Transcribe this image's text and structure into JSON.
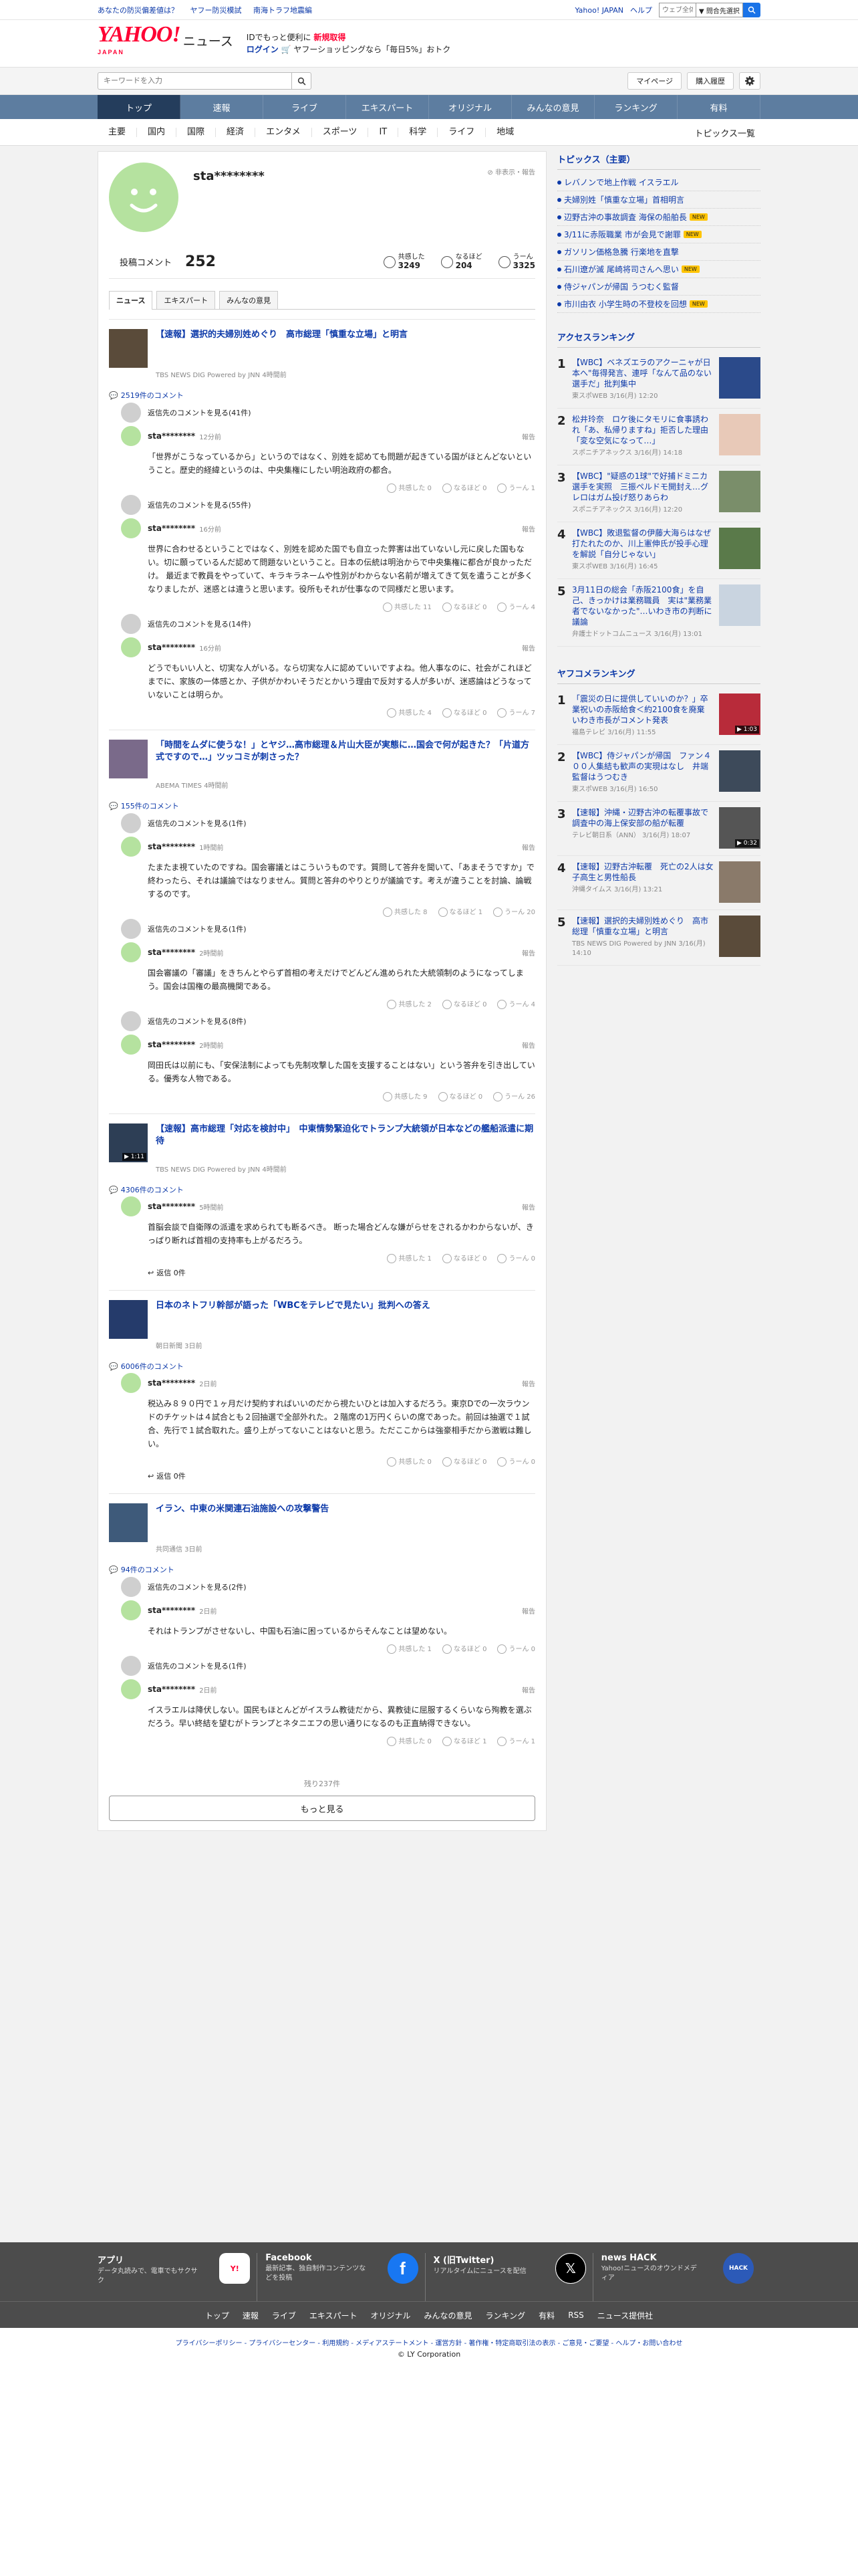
{
  "topstrip": {
    "links": [
      "あなたの防災偏差値は？",
      "ヤフー防災模試",
      "南海トラフ地震編"
    ],
    "right_links": [
      "Yahoo! JAPAN",
      "ヘルプ"
    ],
    "search_placeholder": "ウェブ全体",
    "select_value": "▼ 問合先選択"
  },
  "header": {
    "logo": "YAHOO!",
    "logo_sub": "JAPAN",
    "service": "ニュース",
    "promo_line1_a": "IDでもっと便利に",
    "promo_line1_b": "新規取得",
    "promo_line2_a": "ログイン",
    "promo_line2_b": "ヤフーショッピングなら「毎日5%」おトク"
  },
  "search": {
    "placeholder": "キーワードを入力",
    "mypage": "マイページ",
    "history": "購入履歴"
  },
  "nav": [
    "トップ",
    "速報",
    "ライブ",
    "エキスパート",
    "オリジナル",
    "みんなの意見",
    "ランキング",
    "有料"
  ],
  "subnav": [
    "主要",
    "国内",
    "国際",
    "経済",
    "エンタメ",
    "スポーツ",
    "IT",
    "科学",
    "ライフ",
    "地域"
  ],
  "subnav_right": "トピックス一覧",
  "profile": {
    "name": "sta********",
    "flag": "非表示・報告",
    "comment_label": "投稿コメント",
    "comment_count": "252",
    "reactions": [
      {
        "label": "共感した",
        "value": "3249"
      },
      {
        "label": "なるほど",
        "value": "204"
      },
      {
        "label": "うーん",
        "value": "3325"
      }
    ],
    "tabs": [
      "ニュース",
      "エキスパート",
      "みんなの意見"
    ]
  },
  "articles": [
    {
      "title": "【速報】選択的夫婦別姓めぐり　高市総理「慎重な立場」と明言",
      "source": "TBS NEWS DIG Powered by JNN 4時間前",
      "count": "2519件のコメント",
      "comments": [
        {
          "reply": "返信先のコメントを見る(41件)",
          "name": "sta********",
          "time": "12分前",
          "report": "報告",
          "text": "「世界がこうなっているから」というのではなく、別姓を認めても問題が起きている国がほとんどないということ。歴史的経緯というのは、中央集権にしたい明治政府の都合。",
          "reacts": [
            "共感した 0",
            "なるほど 0",
            "うーん 1"
          ]
        },
        {
          "reply": "返信先のコメントを見る(55件)",
          "name": "sta********",
          "time": "16分前",
          "report": "報告",
          "text": "世界に合わせるということではなく、別姓を認めた国でも自立った弊害は出ていないし元に戻した国もない。切に願っているんだ認めて問題ないということ。日本の伝統は明治からで中央集権に都合が良かっただけ。 最近まで教員をやっていて、キラキラネームや性別がわからない名前が増えてきて気を遣うことが多くなりましたが、迷惑とは違うと思います。役所もそれが仕事なので同様だと思います。",
          "reacts": [
            "共感した 11",
            "なるほど 0",
            "うーん 4"
          ]
        },
        {
          "reply": "返信先のコメントを見る(14件)",
          "name": "sta********",
          "time": "16分前",
          "report": "報告",
          "text": "どうでもいい人と、切実な人がいる。なら切実な人に認めていいですよね。他人事なのに、社会がこれほどまでに、家族の一体感とか、子供がかわいそうだとかいう理由で反対する人が多いが、迷惑論はどうなっていないことは明らか。",
          "reacts": [
            "共感した 4",
            "なるほど 0",
            "うーん 7"
          ]
        }
      ]
    },
    {
      "title": "「時間をムダに使うな！」とヤジ…高市総理＆片山大臣が実態に…国会で何が起きた？「片道方式ですので…」ツッコミが刺さった？",
      "source": "ABEMA TIMES 4時間前",
      "count": "155件のコメント",
      "comments": [
        {
          "reply": "返信先のコメントを見る(1件)",
          "name": "sta********",
          "time": "1時間前",
          "report": "報告",
          "text": "たまたま視ていたのですね。国会審議とはこういうものです。質問して答弁を聞いて、「あまそうですか」で終わったら、それは議論ではなりません。質問と答弁のやりとりが議論です。考えが違うことを討論、論戦するのです。",
          "reacts": [
            "共感した 8",
            "なるほど 1",
            "うーん 20"
          ]
        },
        {
          "reply": "返信先のコメントを見る(1件)",
          "name": "sta********",
          "time": "2時間前",
          "report": "報告",
          "text": "国会審議の「審議」をきちんとやらず首相の考えだけでどんどん進められた大統領制のようになってしまう。国会は国権の最高機関である。",
          "reacts": [
            "共感した 2",
            "なるほど 0",
            "うーん 4"
          ]
        },
        {
          "reply": "返信先のコメントを見る(8件)",
          "name": "sta********",
          "time": "2時間前",
          "report": "報告",
          "text": "岡田氏は以前にも、「安保法制によっても先制攻撃した国を支援することはない」という答弁を引き出している。優秀な人物である。",
          "reacts": [
            "共感した 9",
            "なるほど 0",
            "うーん 26"
          ]
        }
      ]
    },
    {
      "title": "【速報】高市総理「対応を検討中」　中東情勢緊迫化でトランプ大統領が日本などの艦船派遣に期待",
      "source": "TBS NEWS DIG Powered by JNN 4時間前",
      "thumb_badge": "▶ 1:11",
      "count": "4306件のコメント",
      "comments": [
        {
          "reply": "",
          "name": "sta********",
          "time": "5時間前",
          "report": "報告",
          "text": "首脳会談で自衛隊の派遣を求められても断るべき。 断った場合どんな嫌がらせをされるかわからないが、きっぱり断れば首相の支持率も上がるだろう。",
          "reacts": [
            "共感した 1",
            "なるほど 0",
            "うーん 0"
          ],
          "replies": "返信 0件"
        }
      ]
    },
    {
      "title": "日本のネトフリ幹部が語った「WBCをテレビで見たい」批判への答え",
      "source": "朝日新聞 3日前",
      "count": "6006件のコメント",
      "comments": [
        {
          "reply": "",
          "name": "sta********",
          "time": "2日前",
          "report": "報告",
          "text": "税込み８９０円で１ヶ月だけ契約すればいいのだから視たいひとは加入するだろう。東京Dでの一次ラウンドのチケットは４試合とも２回抽選で全部外れた。２階席の1万円くらいの席であった。前回は抽選で１試合、先行で１試合取れた。盛り上がってないことはないと思う。ただここからは強豪相手だから激戦は難しい。",
          "reacts": [
            "共感した 0",
            "なるほど 0",
            "うーん 0"
          ],
          "replies": "返信 0件"
        }
      ]
    },
    {
      "title": "イラン、中東の米関連石油施設への攻撃警告",
      "source": "共同通信 3日前",
      "count": "94件のコメント",
      "comments": [
        {
          "reply": "返信先のコメントを見る(2件)",
          "name": "sta********",
          "time": "2日前",
          "report": "報告",
          "text": "それはトランプがさせないし、中国も石油に困っているからそんなことは望めない。",
          "reacts": [
            "共感した 1",
            "なるほど 0",
            "うーん 0"
          ]
        },
        {
          "reply": "返信先のコメントを見る(1件)",
          "name": "sta********",
          "time": "2日前",
          "report": "報告",
          "text": "イスラエルは降伏しない。国民もほとんどがイスラム教徒だから、異教徒に屈服するくらいなら殉教を選ぶだろう。早い終結を望むがトランプとネタニエフの思い通りになるのも正直納得できない。",
          "reacts": [
            "共感した 0",
            "なるほど 1",
            "うーん 1"
          ]
        }
      ]
    }
  ],
  "more": {
    "remain": "残り237件",
    "button": "もっと見る"
  },
  "sidebar": {
    "topics_title": "トピックス（主要）",
    "topics": [
      {
        "t": "レバノンで地上作戦 イスラエル",
        "new": ""
      },
      {
        "t": "夫婦別姓「慎重な立場」首相明言",
        "new": ""
      },
      {
        "t": "辺野古沖の事故調査 海保の船舶長",
        "new": "NEW"
      },
      {
        "t": "3/11に赤阪職業 市が会見で謝罪",
        "new": "NEW"
      },
      {
        "t": "ガソリン価格急騰 行楽地を直撃",
        "new": ""
      },
      {
        "t": "石川遼が滅 尾崎将司さんへ思い",
        "new": "NEW"
      },
      {
        "t": "侍ジャパンが帰国 うつむく監督",
        "new": ""
      },
      {
        "t": "市川由衣 小学生時の不登校を回想",
        "new": "NEW"
      }
    ],
    "access_title": "アクセスランキング",
    "access": [
      {
        "n": "1",
        "t": "【WBC】ベネズエラのアクーニャが日本へ\"毎得発言、連呼「なんて品のない選手だ」批判集中",
        "s": "東スポWEB 3/16(月) 12:20"
      },
      {
        "n": "2",
        "t": "松井玲奈　ロケ後にタモリに食事誘われ「あ、私帰りますね」拒否した理由「変な空気になって…」",
        "s": "スポニチアネックス 3/16(月) 14:18"
      },
      {
        "n": "3",
        "t": "【WBC】\"疑惑の1球\"で好捕ドミニカ選手を実照　三振ペルドモ開封え…グレロはガム投げ怒りあらわ",
        "s": "スポニチアネックス 3/16(月) 12:20"
      },
      {
        "n": "4",
        "t": "【WBC】敗退監督の伊藤大海らはなぜ打たれたのか、川上憲伸氏が投手心理を解説「自分じゃない」",
        "s": "東スポWEB 3/16(月) 16:45"
      },
      {
        "n": "5",
        "t": "3月11日の総会「赤阪2100食」を自己、きっかけは業務職員　実は\"業務業者でないなかった\"…いわき市の判断に議論",
        "s": "弁護士ドットコムニュース 3/16(月) 13:01"
      }
    ],
    "comment_title": "ヤフコメランキング",
    "comment_rank": [
      {
        "n": "1",
        "t": "「震災の日に提供していいのか？」卒業祝いの赤阪給食＜約2100食を廃棄　いわき市長がコメント発表",
        "s": "福島テレビ 3/16(月) 11:55",
        "badge": "▶ 1:03"
      },
      {
        "n": "2",
        "t": "【WBC】侍ジャパンが帰国　ファン４００人集結も歓声の実現はなし　井端監督はうつむき",
        "s": "東スポWEB 3/16(月) 16:50",
        "badge": ""
      },
      {
        "n": "3",
        "t": "【速報】沖縄・辺野古沖の転覆事故で調査中の海上保安部の船が転覆",
        "s": "テレビ朝日系（ANN） 3/16(月) 18:07",
        "badge": "▶ 0:32"
      },
      {
        "n": "4",
        "t": "【速報】辺野古沖転覆　死亡の2人は女子高生と男性船長",
        "s": "沖縄タイムス 3/16(月) 13:21",
        "badge": ""
      },
      {
        "n": "5",
        "t": "【速報】選択的夫婦別姓めぐり　高市総理「慎重な立場」と明言",
        "s": "TBS NEWS DIG Powered by JNN 3/16(月) 14:10",
        "badge": ""
      }
    ]
  },
  "footer": {
    "boxes": [
      {
        "title": "アプリ",
        "desc": "データ丸読みで、電車でもサクサク"
      },
      {
        "title": "Facebook",
        "desc": "最新記事、独自制作コンテンツなどを投稿"
      },
      {
        "title": "X (旧Twitter)",
        "desc": "リアルタイムにニュースを配信"
      },
      {
        "title": "news HACK",
        "desc": "Yahoo!ニュースのオウンドメディア"
      }
    ],
    "nav": [
      "トップ",
      "速報",
      "ライブ",
      "エキスパート",
      "オリジナル",
      "みんなの意見",
      "ランキング",
      "有料",
      "RSS",
      "ニュース提供社"
    ],
    "legal": "プライバシーポリシー - プライバシーセンター - 利用規約 - メディアステートメント - 運営方針 - 著作権・特定商取引法の表示 - ご意見・ご要望 - ヘルプ・お問い合わせ",
    "copyright": "© LY Corporation"
  },
  "colors": {
    "accent": "#ff0033",
    "nav": "#5d7da0",
    "link": "#0d3aa9",
    "avatar": "#b5e29f"
  }
}
